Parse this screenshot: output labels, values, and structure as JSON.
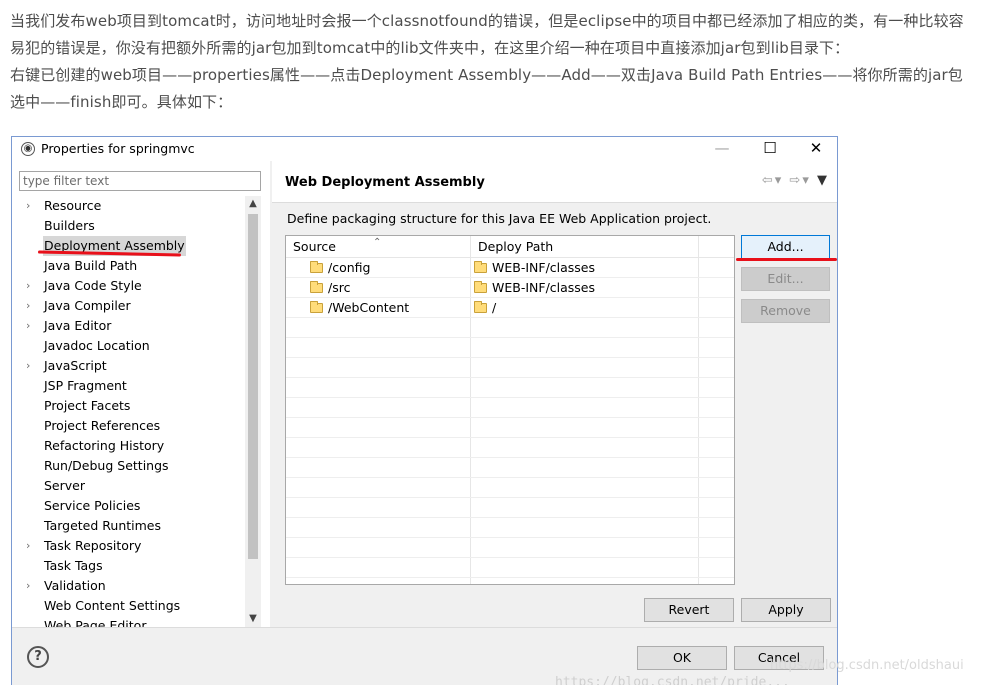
{
  "article": {
    "paragraph1": "当我们发布web项目到tomcat时，访问地址时会报一个classnotfound的错误，但是eclipse中的项目中都已经添加了相应的类，有一种比较容易犯的错误是，你没有把额外所需的jar包加到tomcat中的lib文件夹中，在这里介绍一种在项目中直接添加jar包到lib目录下：",
    "paragraph2": "右键已创建的web项目——properties属性——点击Deployment Assembly——Add——双击Java Build Path Entries——将你所需的jar包选中——finish即可。具体如下："
  },
  "dialog": {
    "title": "Properties for springmvc",
    "filter_placeholder": "type filter text",
    "tree_items": [
      {
        "label": "Resource",
        "expandable": true
      },
      {
        "label": "Builders",
        "expandable": false
      },
      {
        "label": "Deployment Assembly",
        "expandable": false,
        "selected": true
      },
      {
        "label": "Java Build Path",
        "expandable": false
      },
      {
        "label": "Java Code Style",
        "expandable": true
      },
      {
        "label": "Java Compiler",
        "expandable": true
      },
      {
        "label": "Java Editor",
        "expandable": true
      },
      {
        "label": "Javadoc Location",
        "expandable": false
      },
      {
        "label": "JavaScript",
        "expandable": true
      },
      {
        "label": "JSP Fragment",
        "expandable": false
      },
      {
        "label": "Project Facets",
        "expandable": false
      },
      {
        "label": "Project References",
        "expandable": false
      },
      {
        "label": "Refactoring History",
        "expandable": false
      },
      {
        "label": "Run/Debug Settings",
        "expandable": false
      },
      {
        "label": "Server",
        "expandable": false
      },
      {
        "label": "Service Policies",
        "expandable": false
      },
      {
        "label": "Targeted Runtimes",
        "expandable": false
      },
      {
        "label": "Task Repository",
        "expandable": true
      },
      {
        "label": "Task Tags",
        "expandable": false
      },
      {
        "label": "Validation",
        "expandable": true
      },
      {
        "label": "Web Content Settings",
        "expandable": false
      },
      {
        "label": "Web Page Editor",
        "expandable": false
      }
    ],
    "panel": {
      "title": "Web Deployment Assembly",
      "description": "Define packaging structure for this Java EE Web Application project.",
      "columns": {
        "source": "Source",
        "deploy_path": "Deploy Path"
      },
      "rows": [
        {
          "source": "/config",
          "deploy_path": "WEB-INF/classes"
        },
        {
          "source": "/src",
          "deploy_path": "WEB-INF/classes"
        },
        {
          "source": "/WebContent",
          "deploy_path": "/"
        }
      ],
      "buttons": {
        "add": "Add...",
        "edit": "Edit...",
        "remove": "Remove",
        "revert": "Revert",
        "apply": "Apply"
      }
    },
    "footer": {
      "ok": "OK",
      "cancel": "Cancel"
    }
  },
  "watermark": {
    "line1": "https://blog.csdn.net/oldshaui",
    "line2": "https://blog.csdn.net/pride..."
  },
  "colors": {
    "annotation_red": "#e8101a",
    "primary_border": "#0078d7"
  }
}
